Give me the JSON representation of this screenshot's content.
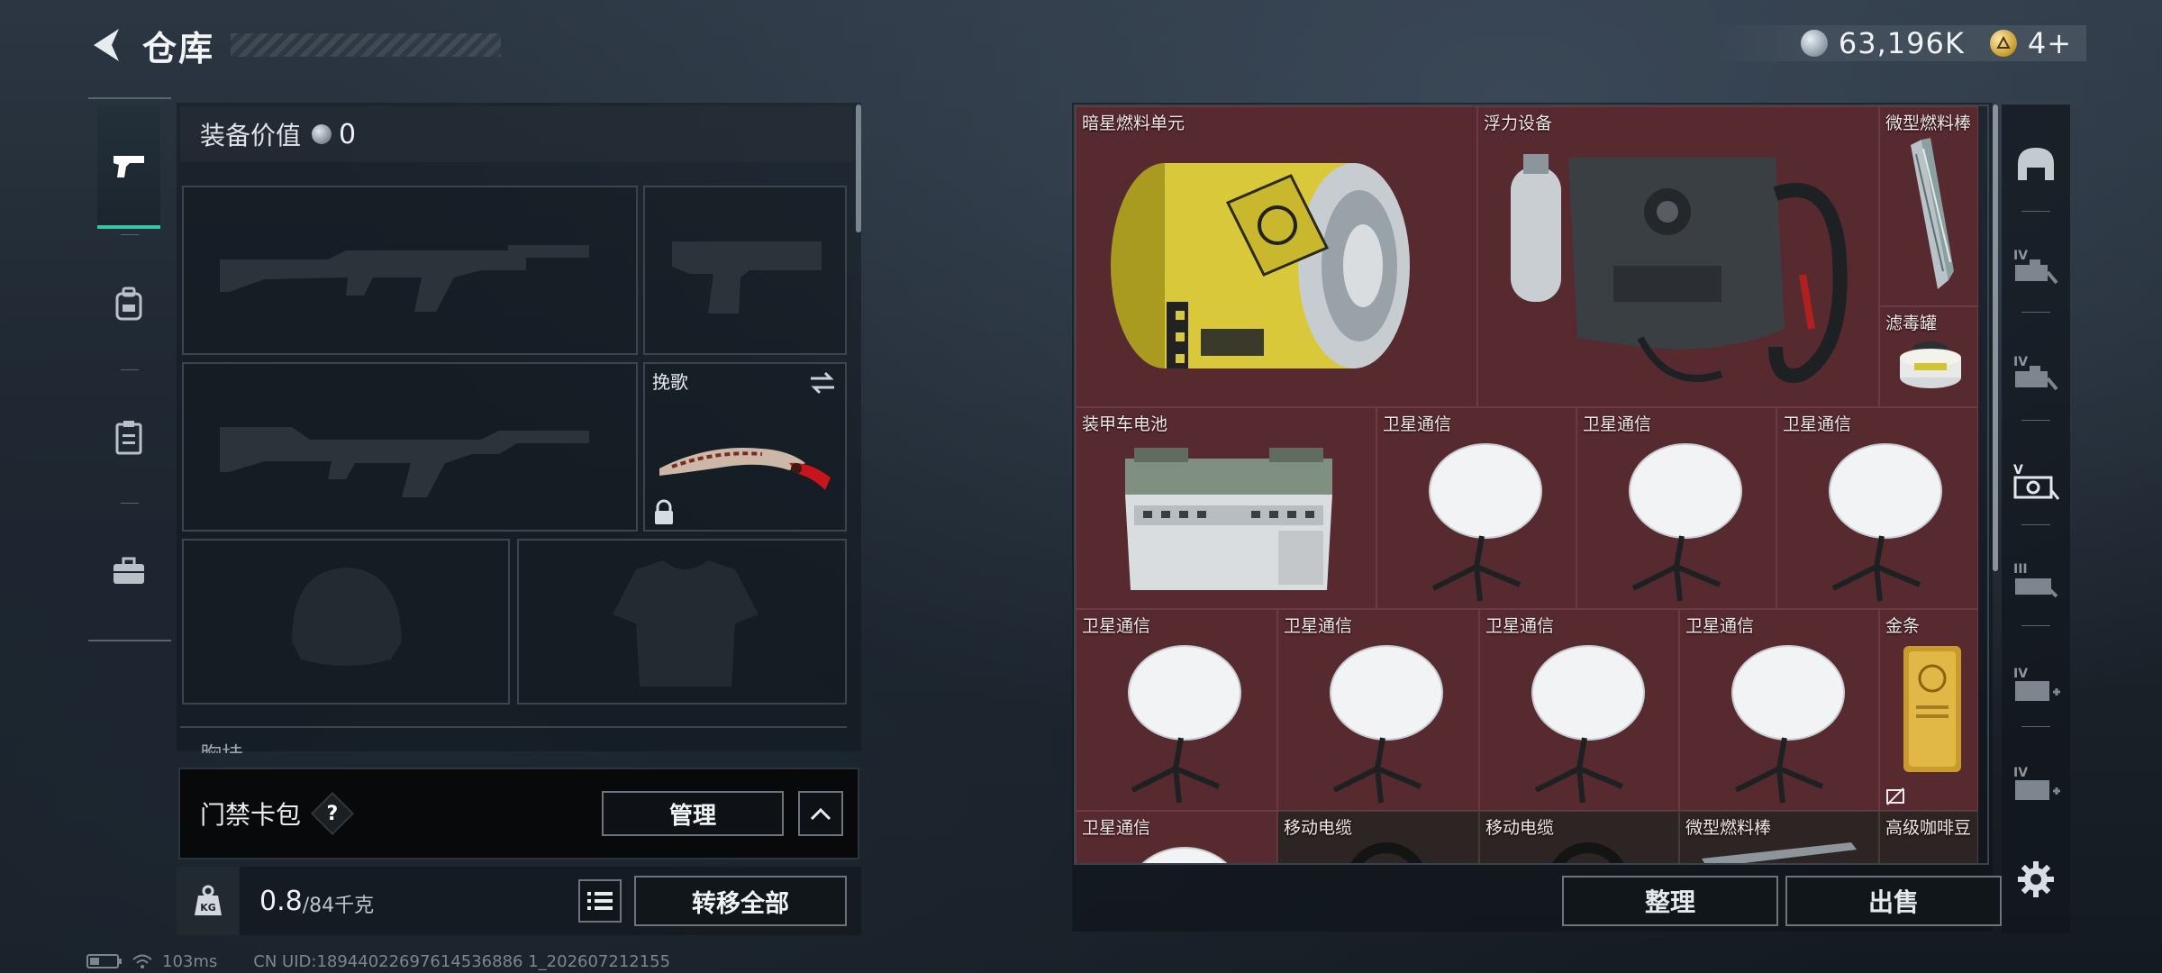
{
  "header": {
    "title": "仓库",
    "currencies": [
      {
        "icon": "silver-coin-icon",
        "value": "63,196K"
      },
      {
        "icon": "gold-coin-icon",
        "value": "4+"
      }
    ]
  },
  "left_tabs": [
    {
      "name": "tab-weapons",
      "icon": "pistol-icon",
      "active": true
    },
    {
      "name": "tab-armor",
      "icon": "backpack-icon",
      "active": false
    },
    {
      "name": "tab-supplies",
      "icon": "clipboard-icon",
      "active": false
    },
    {
      "name": "tab-case",
      "icon": "briefcase-icon",
      "active": false
    }
  ],
  "loadout": {
    "value_label": "装备价值",
    "value": "0",
    "slots": [
      {
        "name": "primary-weapon-slot",
        "label": "",
        "item": "rifle-silhouette"
      },
      {
        "name": "pistol-slot",
        "label": "",
        "item": "pistol-silhouette"
      },
      {
        "name": "secondary-weapon-slot",
        "label": "",
        "item": "rifle-silhouette"
      },
      {
        "name": "melee-slot",
        "label": "挽歌",
        "item": "knife"
      },
      {
        "name": "helmet-slot",
        "label": "",
        "item": "helmet-silhouette"
      },
      {
        "name": "body-armor-slot",
        "label": "",
        "item": "armor-silhouette"
      }
    ],
    "chest_rig_label": "胸挂",
    "keycard": {
      "label": "门禁卡包",
      "help": "?",
      "manage": "管理"
    },
    "weight": {
      "current": "0.8",
      "max": "/84千克",
      "icon_text": "KG"
    },
    "transfer_all": "转移全部"
  },
  "stash": {
    "items": [
      {
        "name": "暗星燃料单元",
        "art": "fuel-canister"
      },
      {
        "name": "浮力设备",
        "art": "buoyancy-device"
      },
      {
        "name": "微型燃料棒",
        "art": "fuel-rod"
      },
      {
        "name": "滤毒罐",
        "art": "filter-canister"
      },
      {
        "name": "装甲车电池",
        "art": "battery"
      },
      {
        "name": "卫星通信",
        "art": "satellite-dish"
      },
      {
        "name": "卫星通信",
        "art": "satellite-dish"
      },
      {
        "name": "卫星通信",
        "art": "satellite-dish"
      },
      {
        "name": "卫星通信",
        "art": "satellite-dish"
      },
      {
        "name": "卫星通信",
        "art": "satellite-dish"
      },
      {
        "name": "卫星通信",
        "art": "satellite-dish"
      },
      {
        "name": "卫星通信",
        "art": "satellite-dish"
      },
      {
        "name": "金条",
        "art": "gold-bar"
      },
      {
        "name": "卫星通信",
        "art": "satellite-dish"
      },
      {
        "name": "移动电缆",
        "art": "cable"
      },
      {
        "name": "移动电缆",
        "art": "cable"
      },
      {
        "name": "微型燃料棒",
        "art": "fuel-rod"
      },
      {
        "name": "高级咖啡豆",
        "art": "coffee"
      }
    ],
    "sort": "整理",
    "sell": "出售"
  },
  "right_tabs": [
    {
      "name": "tab-all",
      "icon": "helmet-icon"
    },
    {
      "name": "tab-iv-weapon",
      "icon": "iv-weapon-icon",
      "level": "IV"
    },
    {
      "name": "tab-iv-weapon-2",
      "icon": "iv-weapon-icon",
      "level": "IV"
    },
    {
      "name": "tab-v-equipment",
      "icon": "v-equipment-icon",
      "level": "V"
    },
    {
      "name": "tab-iii-equipment",
      "icon": "iii-equipment-icon",
      "level": "III"
    },
    {
      "name": "tab-iv-add",
      "icon": "iv-add-icon",
      "level": "IV"
    },
    {
      "name": "tab-iv-add-2",
      "icon": "iv-add-icon",
      "level": "IV"
    },
    {
      "name": "settings",
      "icon": "gear-icon"
    }
  ],
  "status": {
    "ping": "103ms",
    "uid": "CN UID:18944022697614536886 1_202607212155"
  }
}
